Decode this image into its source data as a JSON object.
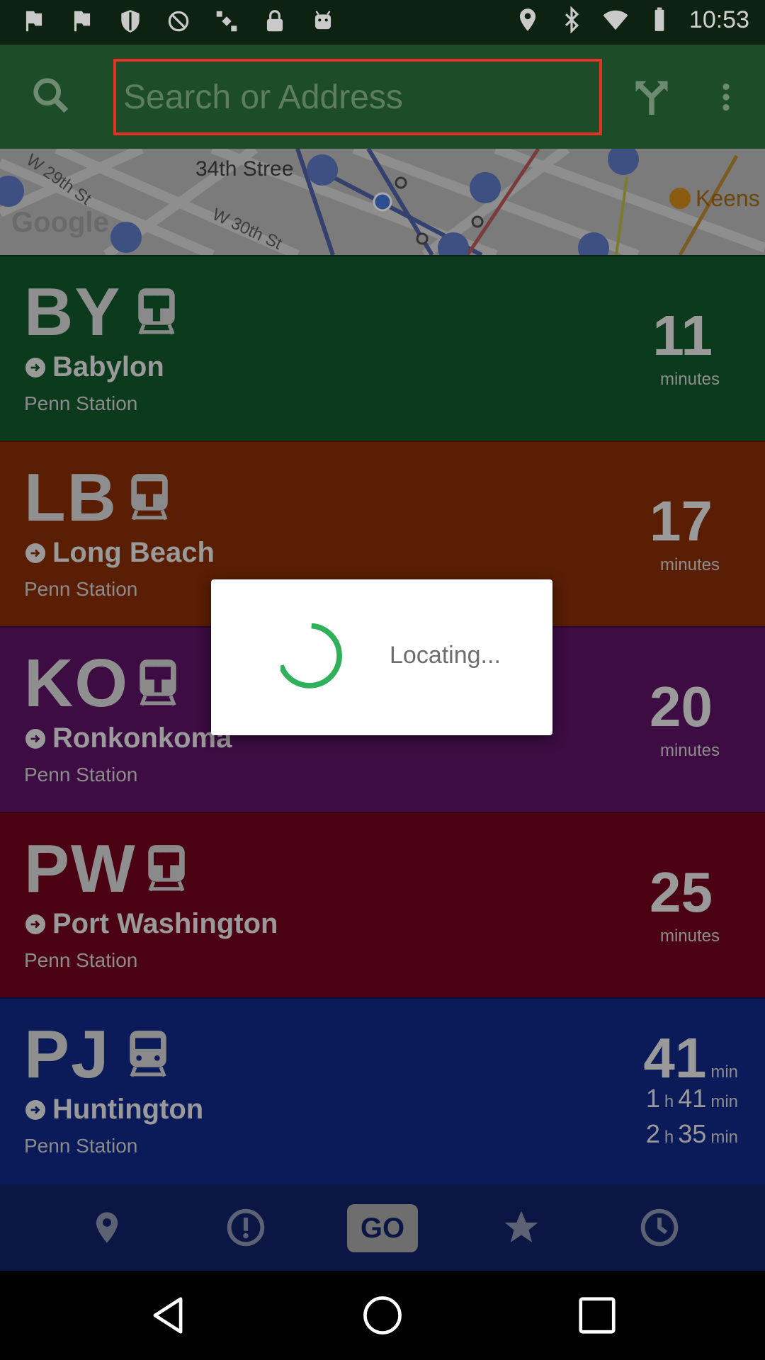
{
  "statusbar": {
    "time": "10:53",
    "icons": [
      "flag-icon",
      "flag-icon",
      "shield-icon",
      "no-sim-icon",
      "satellite-icon",
      "lock-icon",
      "android-icon",
      "location-icon",
      "bluetooth-icon",
      "wifi-icon",
      "battery-icon"
    ]
  },
  "appbar": {
    "search_placeholder": "Search or Address",
    "search_value": "",
    "highlight_color": "#e53222"
  },
  "map": {
    "street_labels": [
      "W 29th St",
      "34th Stree",
      "W 30th St",
      "Keens"
    ],
    "attribution": "Google"
  },
  "routes": [
    {
      "code": "BY",
      "destination": "Babylon",
      "origin": "Penn Station",
      "minutes": "11",
      "minutes_label": "minutes",
      "color": "#0c3a1d"
    },
    {
      "code": "LB",
      "destination": "Long Beach",
      "origin": "Penn Station",
      "minutes": "17",
      "minutes_label": "minutes",
      "color": "#5a1e04"
    },
    {
      "code": "KO",
      "destination": "Ronkonkoma",
      "origin": "Penn Station",
      "minutes": "20",
      "minutes_label": "minutes",
      "color": "#3d0c42"
    },
    {
      "code": "PW",
      "destination": "Port Washington",
      "origin": "Penn Station",
      "minutes": "25",
      "minutes_label": "minutes",
      "color": "#4b0313"
    },
    {
      "code": "PJ",
      "destination": "Huntington",
      "origin": "Penn Station",
      "color": "#0b1a58",
      "times": [
        {
          "hours": "",
          "minutes": "41",
          "min_unit": "min"
        },
        {
          "hours": "1",
          "hours_unit": "h",
          "minutes": "41",
          "min_unit": "min"
        },
        {
          "hours": "2",
          "hours_unit": "h",
          "minutes": "35",
          "min_unit": "min"
        }
      ]
    }
  ],
  "bottomnav": {
    "items": [
      "location-pin-icon",
      "alert-icon",
      "go-button",
      "star-icon",
      "clock-icon"
    ],
    "go_label": "GO"
  },
  "dialog": {
    "message": "Locating...",
    "spinner_color": "#2eb15a"
  }
}
